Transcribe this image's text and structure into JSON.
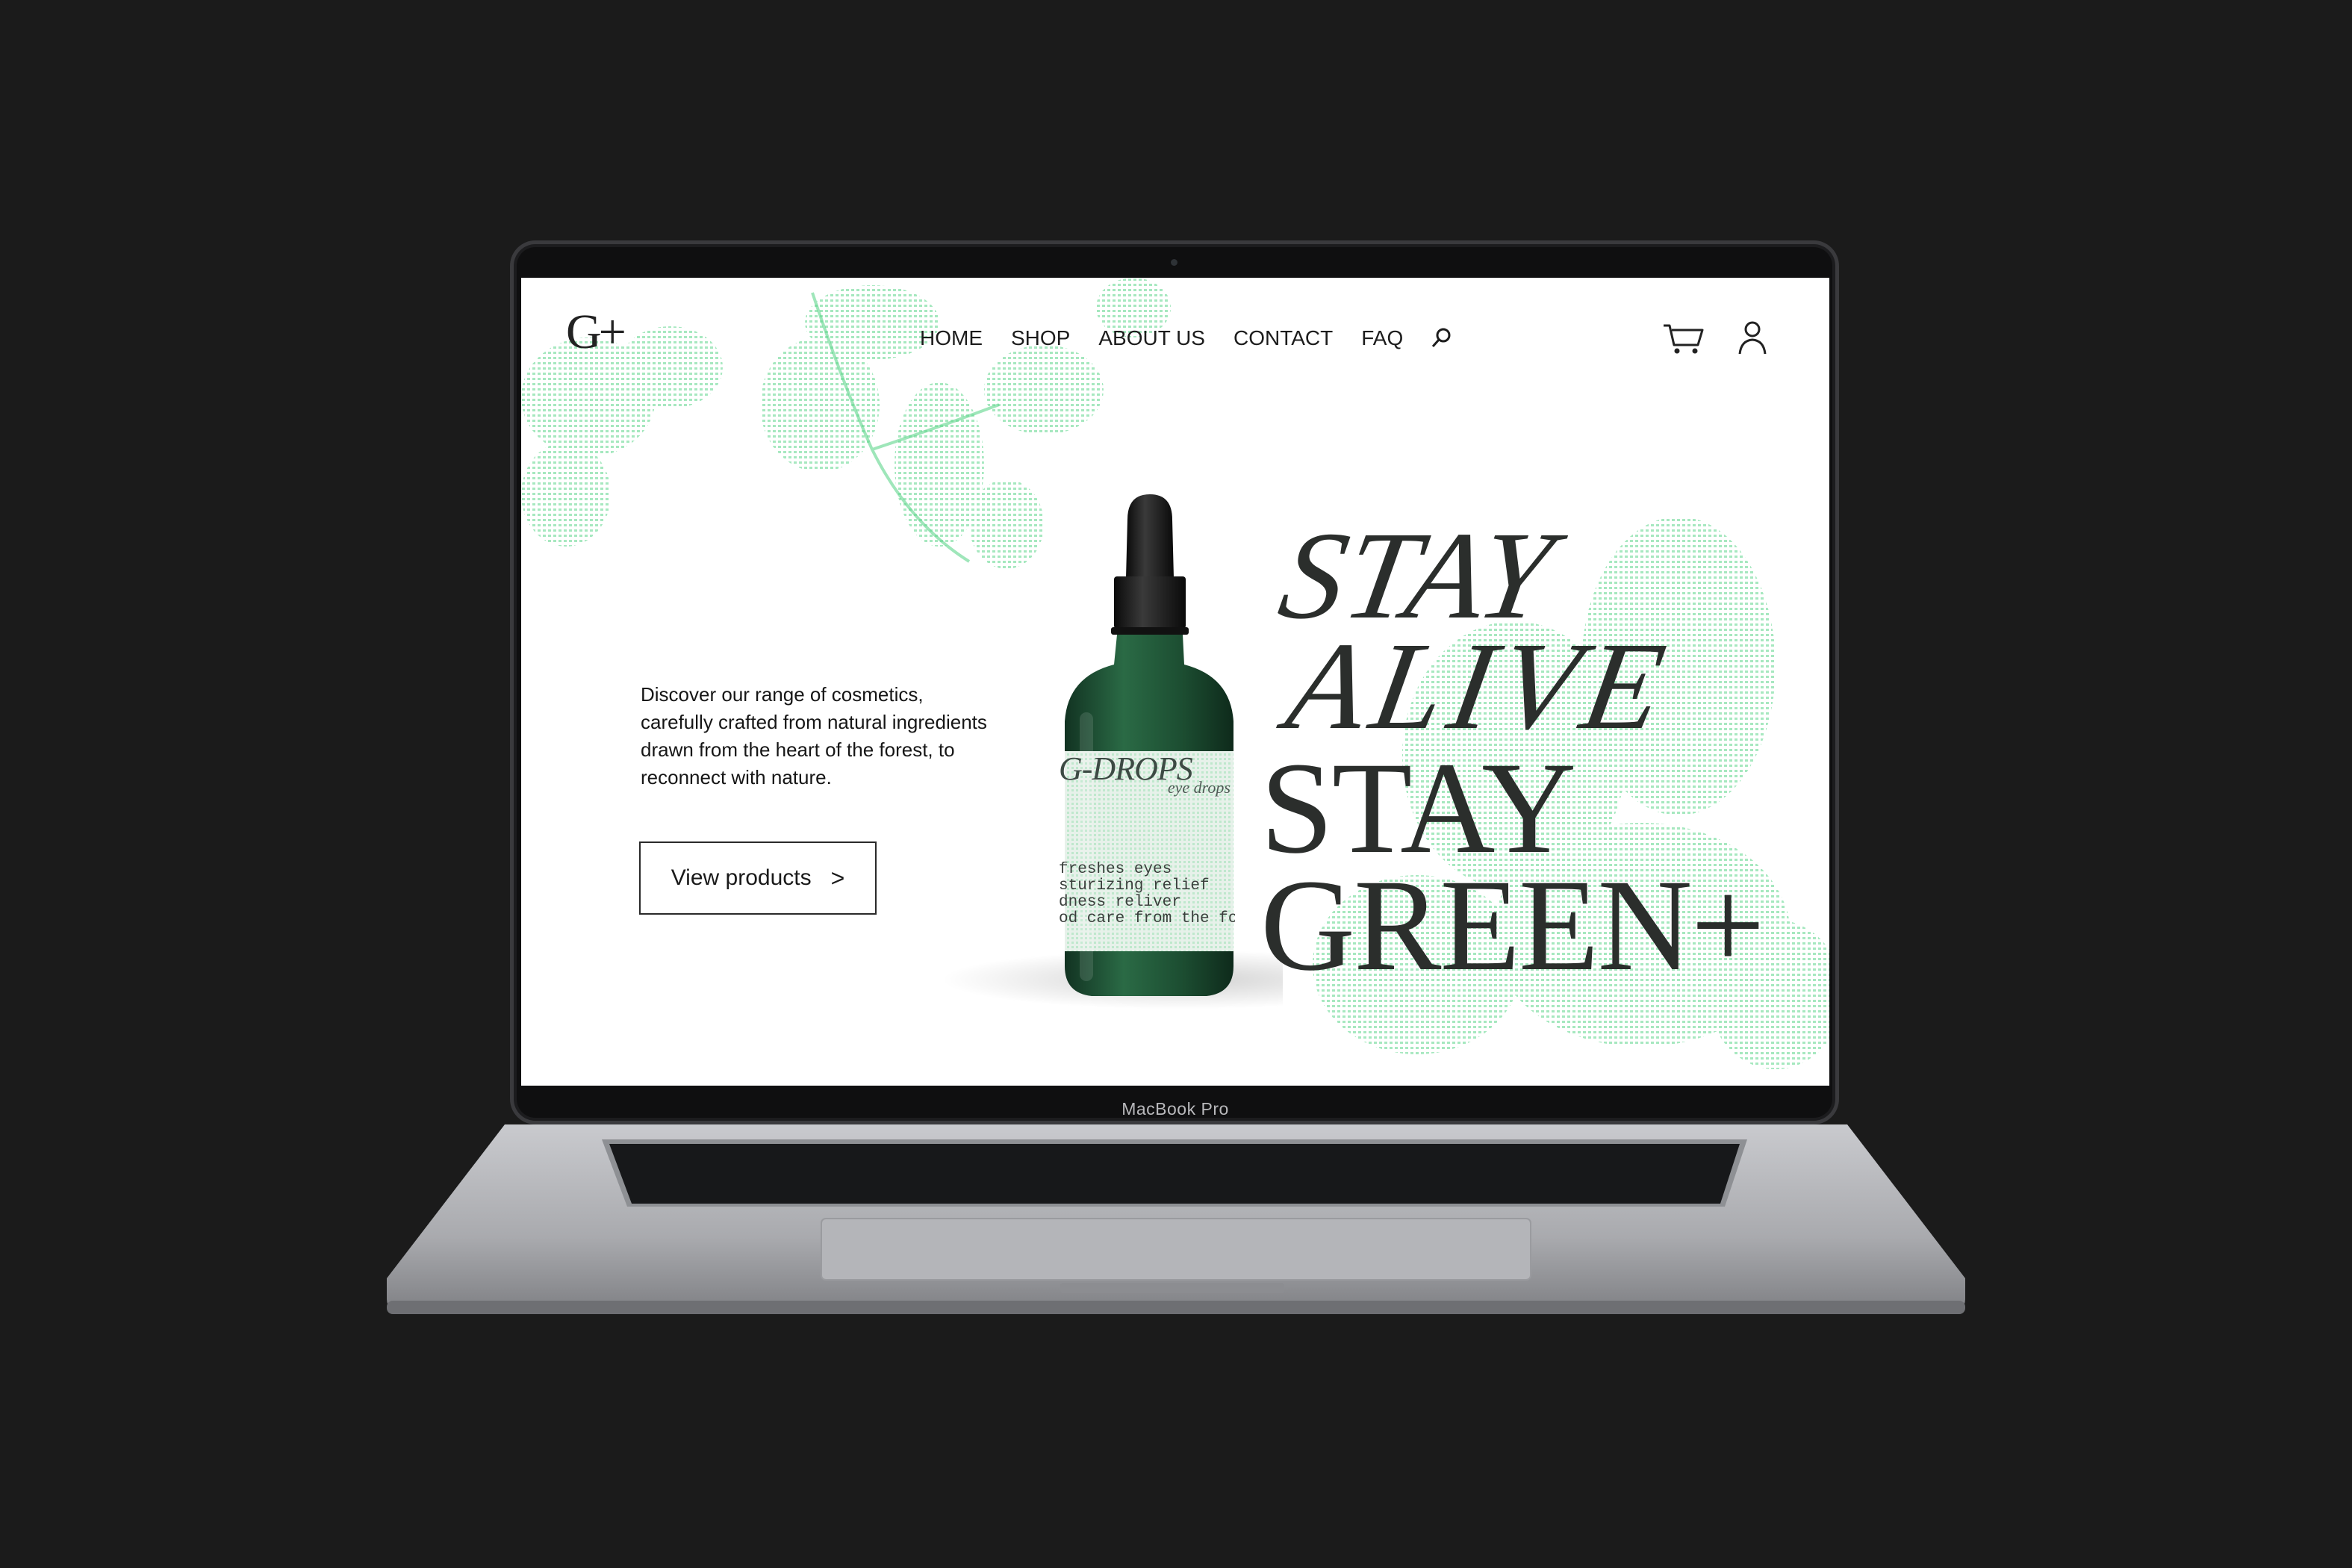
{
  "device": {
    "model_label": "MacBook Pro"
  },
  "site": {
    "logo": "G+",
    "nav": [
      "HOME",
      "SHOP",
      "ABOUT US",
      "CONTACT",
      "FAQ"
    ],
    "icons": {
      "search": "search-icon",
      "cart": "cart-icon",
      "account": "user-icon"
    }
  },
  "hero": {
    "description": "Discover our range of cosmetics, carefully crafted from natural ingredients drawn from the heart of the forest, to reconnect with nature.",
    "cta_label": "View products",
    "cta_arrow": ">",
    "headline": [
      "STAY",
      "ALIVE",
      "STAY",
      "GREEN+"
    ]
  },
  "product": {
    "brand": "G-DROPS",
    "subtitle": "eye drops",
    "label_lines": [
      "freshes eyes",
      "sturizing relief",
      "dness reliver",
      "od care from the fox"
    ],
    "bottle_color": "#1f4a30"
  },
  "colors": {
    "accent_green": "#5fd68c",
    "text_dark": "#2b2e2c",
    "background": "#1b1b1b"
  }
}
